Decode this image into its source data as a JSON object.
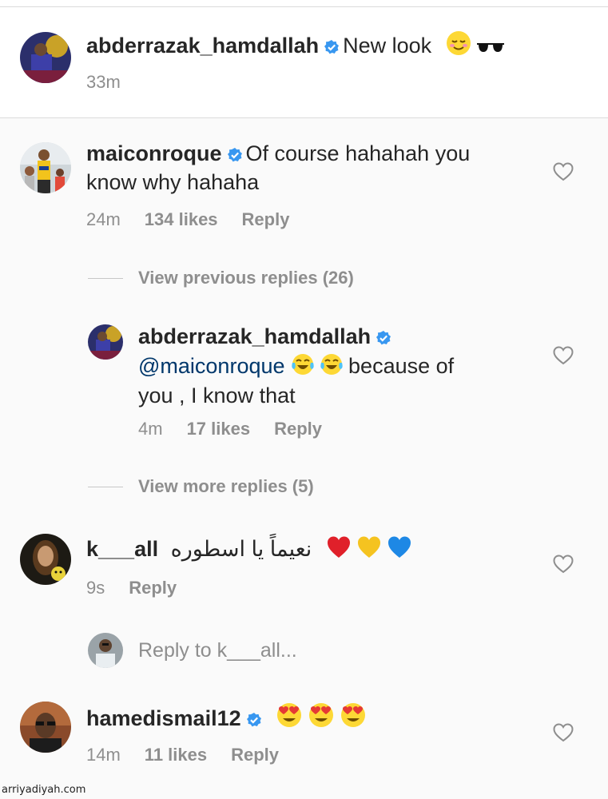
{
  "caption": {
    "username": "abderrazak_hamdallah",
    "text": "New look",
    "time": "33m"
  },
  "comments": [
    {
      "username": "maiconroque",
      "text_line1": "Of course hahahah you",
      "text_line2": "know why hahaha",
      "time": "24m",
      "likes": "134 likes",
      "reply": "Reply"
    },
    {
      "username": "k___all",
      "text": "نعيماً يا اسطوره",
      "time": "9s",
      "reply": "Reply"
    },
    {
      "username": "hamedismail12",
      "time": "14m",
      "likes": "11 likes",
      "reply": "Reply"
    }
  ],
  "view_previous": "View previous replies (26)",
  "view_more": "View more replies (5)",
  "reply_comment": {
    "username": "abderrazak_hamdallah",
    "mention": "@maiconroque",
    "text_part1": "because of",
    "text_line2": "you , I know that",
    "time": "4m",
    "likes": "17 likes",
    "reply": "Reply"
  },
  "reply_input": {
    "placeholder": "Reply to k___all..."
  },
  "watermark": "arriyadiyah.com",
  "colors": {
    "verified": "#3897f0",
    "secondary_text": "#8e8e8e",
    "mention": "#00376b"
  }
}
